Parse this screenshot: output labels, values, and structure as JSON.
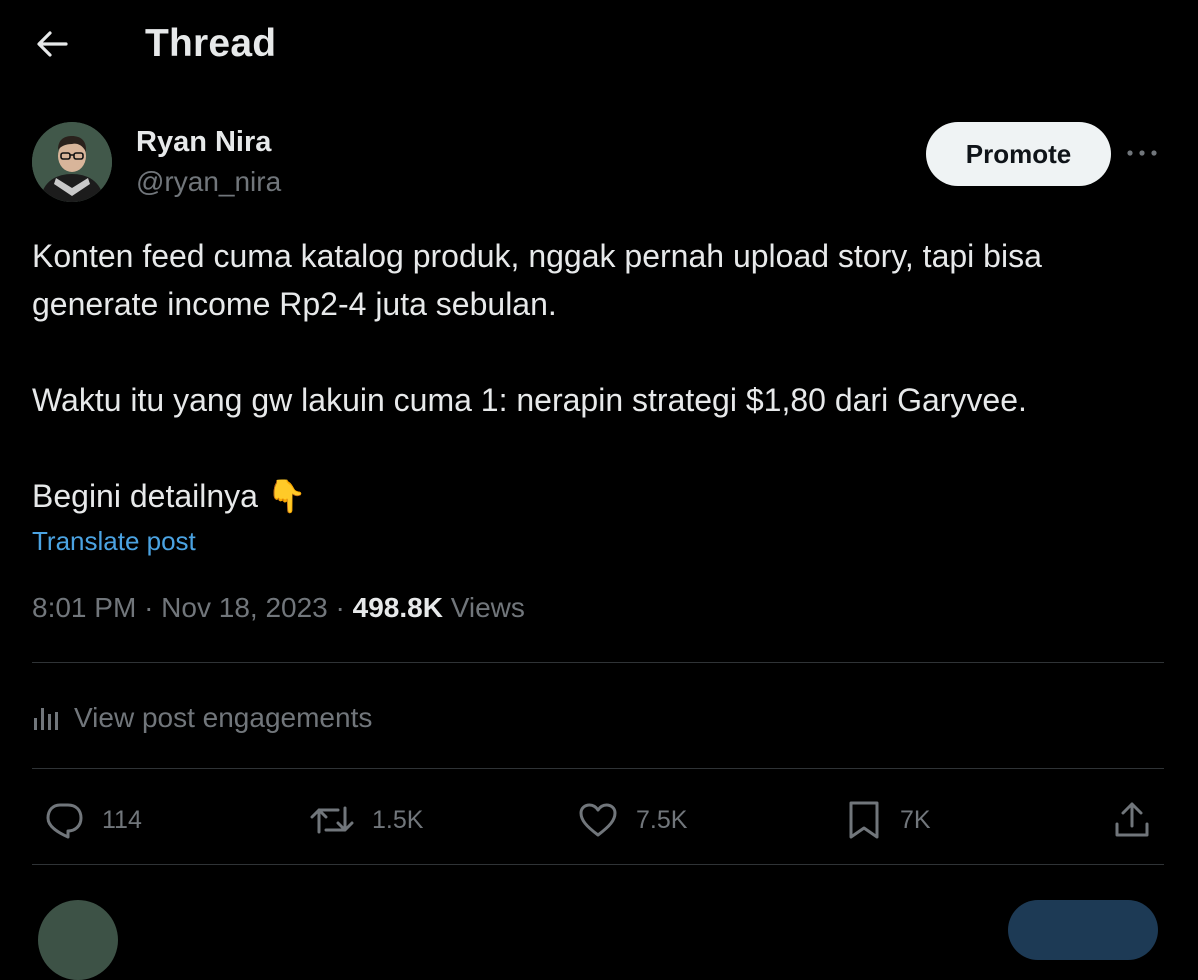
{
  "header": {
    "title": "Thread"
  },
  "post": {
    "author": {
      "name": "Ryan Nira",
      "handle": "@ryan_nira"
    },
    "promote_label": "Promote",
    "text_lines": {
      "line1": "Konten feed cuma katalog produk, nggak pernah upload story, tapi bisa",
      "line2": "generate income Rp2-4 juta sebulan.",
      "line3": "Waktu itu yang gw lakuin cuma 1: nerapin strategi $1,80 dari Garyvee.",
      "line4": "Begini detailnya 👇"
    },
    "translate_label": "Translate post",
    "time": "8:01 PM",
    "date": "Nov 18, 2023",
    "separator": "·",
    "views_count": "498.8K",
    "views_label": "Views",
    "engagements_label": "View post engagements",
    "actions": {
      "replies": "114",
      "reposts": "1.5K",
      "likes": "7.5K",
      "bookmarks": "7K"
    }
  },
  "colors": {
    "background": "#000000",
    "text": "#e7e9ea",
    "muted": "#71767b",
    "link": "#4ba3e2",
    "divider": "#2f3336"
  }
}
